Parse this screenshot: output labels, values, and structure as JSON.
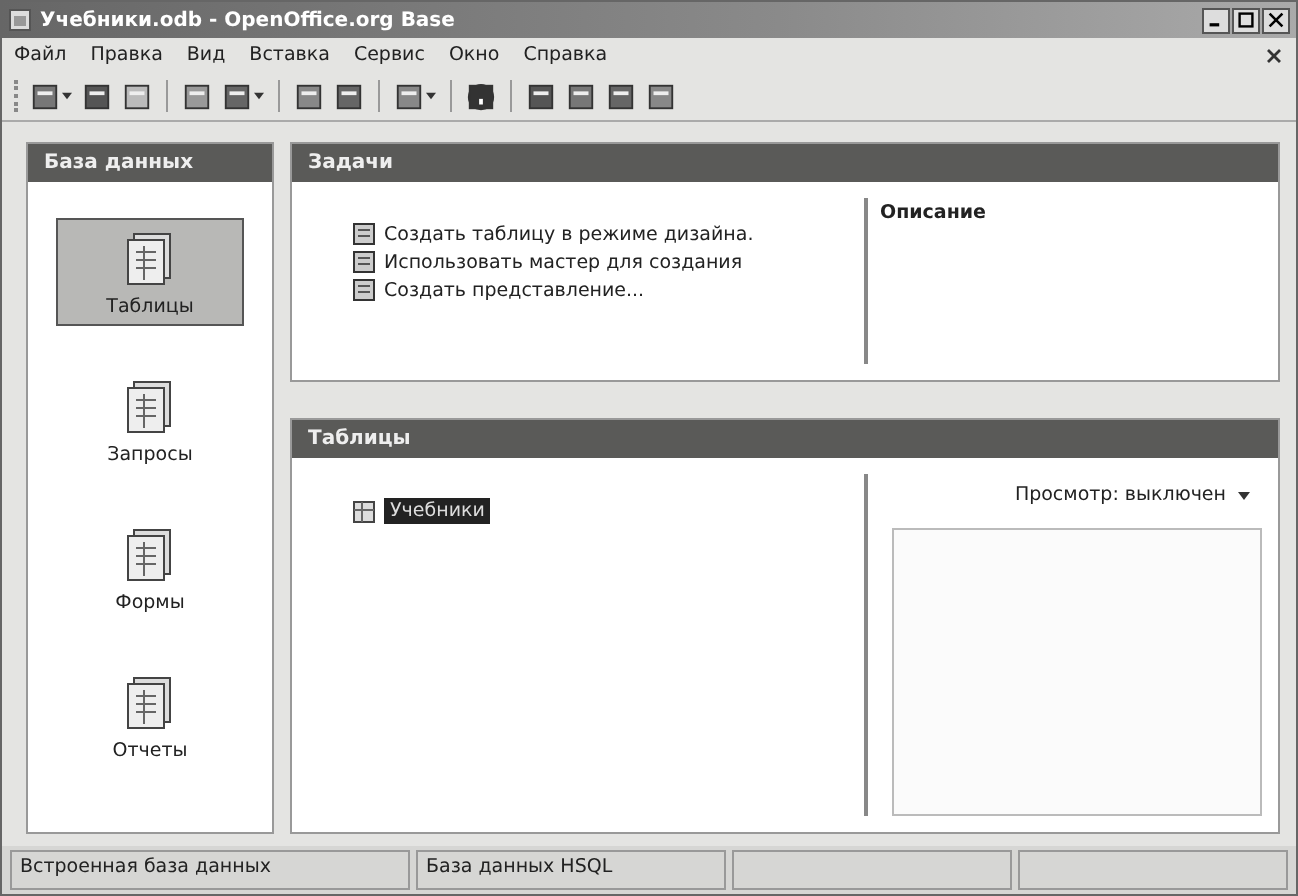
{
  "window": {
    "title": "Учебники.odb - OpenOffice.org Base"
  },
  "menu": [
    "Файл",
    "Правка",
    "Вид",
    "Вставка",
    "Сервис",
    "Окно",
    "Справка"
  ],
  "toolbar": [
    {
      "kind": "new",
      "dropdown": true
    },
    {
      "kind": "open",
      "dropdown": false
    },
    {
      "kind": "save",
      "dropdown": false
    },
    {
      "kind": "copy",
      "dropdown": false
    },
    {
      "kind": "paste",
      "dropdown": true
    },
    {
      "kind": "sort-asc",
      "dropdown": false
    },
    {
      "kind": "sort-desc",
      "dropdown": false
    },
    {
      "kind": "form",
      "dropdown": true
    },
    {
      "kind": "help",
      "dropdown": false
    },
    {
      "kind": "table",
      "dropdown": false
    },
    {
      "kind": "query",
      "dropdown": false
    },
    {
      "kind": "report",
      "dropdown": false
    },
    {
      "kind": "form",
      "dropdown": false
    }
  ],
  "sidebar": {
    "title": "База данных",
    "items": [
      {
        "label": "Таблицы",
        "selected": true
      },
      {
        "label": "Запросы",
        "selected": false
      },
      {
        "label": "Формы",
        "selected": false
      },
      {
        "label": "Отчеты",
        "selected": false
      }
    ]
  },
  "tasks": {
    "title": "Задачи",
    "items": [
      "Создать таблицу в режиме дизайна.",
      "Использовать мастер для создания",
      "Создать представление..."
    ],
    "description_title": "Описание"
  },
  "tables": {
    "title": "Таблицы",
    "items": [
      {
        "label": "Учебники",
        "selected": true
      }
    ],
    "preview": "Просмотр: выключен"
  },
  "status_bar": [
    "Встроенная база данных",
    "База данных HSQL"
  ]
}
